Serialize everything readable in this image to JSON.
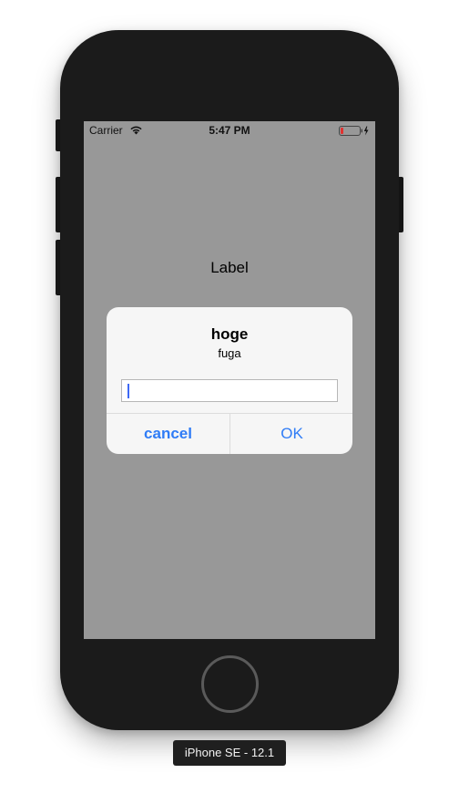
{
  "status_bar": {
    "carrier": "Carrier",
    "time": "5:47 PM",
    "wifi_icon": "wifi-icon",
    "battery_icon": "battery-icon",
    "battery_level_percent": 15,
    "charging": true
  },
  "screen": {
    "label": "Label",
    "background_color": "#989898"
  },
  "alert": {
    "title": "hoge",
    "message": "fuga",
    "text_field": {
      "value": "",
      "placeholder": ""
    },
    "buttons": {
      "cancel": "cancel",
      "ok": "OK"
    },
    "accent_color": "#2f7cf6"
  },
  "device": {
    "name": "iPhone SE - 12.1"
  }
}
